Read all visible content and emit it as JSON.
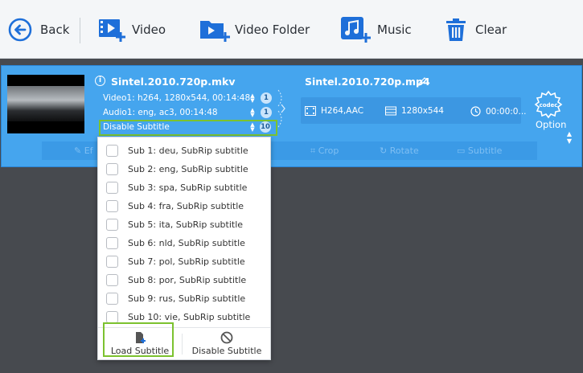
{
  "toolbar": {
    "back_label": "Back",
    "video_label": "Video",
    "video_folder_label": "Video Folder",
    "music_label": "Music",
    "clear_label": "Clear"
  },
  "source": {
    "filename": "Sintel.2010.720p.mkv",
    "video_track": "Video1: h264, 1280x544, 00:14:48",
    "video_count": "1",
    "audio_track": "Audio1: eng, ac3, 00:14:48",
    "audio_count": "1",
    "subtitle_selected": "Disable Subtitle",
    "subtitle_count": "10"
  },
  "output": {
    "filename": "Sintel.2010.720p.mp4",
    "codec": "H264,AAC",
    "resolution": "1280x544",
    "duration": "00:00:0...",
    "codec_badge": "codec",
    "option_label": "Option"
  },
  "edit_tools": {
    "effect": "Ef",
    "crop": "Crop",
    "rotate": "Rotate",
    "subtitle": "Subtitle"
  },
  "subtitle_options": [
    "Sub 1: deu, SubRip subtitle",
    "Sub 2: eng, SubRip subtitle",
    "Sub 3: spa, SubRip subtitle",
    "Sub 4: fra, SubRip subtitle",
    "Sub 5: ita, SubRip subtitle",
    "Sub 6: nld, SubRip subtitle",
    "Sub 7: pol, SubRip subtitle",
    "Sub 8: por, SubRip subtitle",
    "Sub 9: rus, SubRip subtitle",
    "Sub 10: vie, SubRip subtitle"
  ],
  "dropdown_footer": {
    "load_label": "Load Subtitle",
    "disable_label": "Disable Subtitle"
  },
  "colors": {
    "toolbar_icon": "#1e6fd9",
    "panel": "#45a5ee",
    "highlight": "#7cc22f"
  }
}
